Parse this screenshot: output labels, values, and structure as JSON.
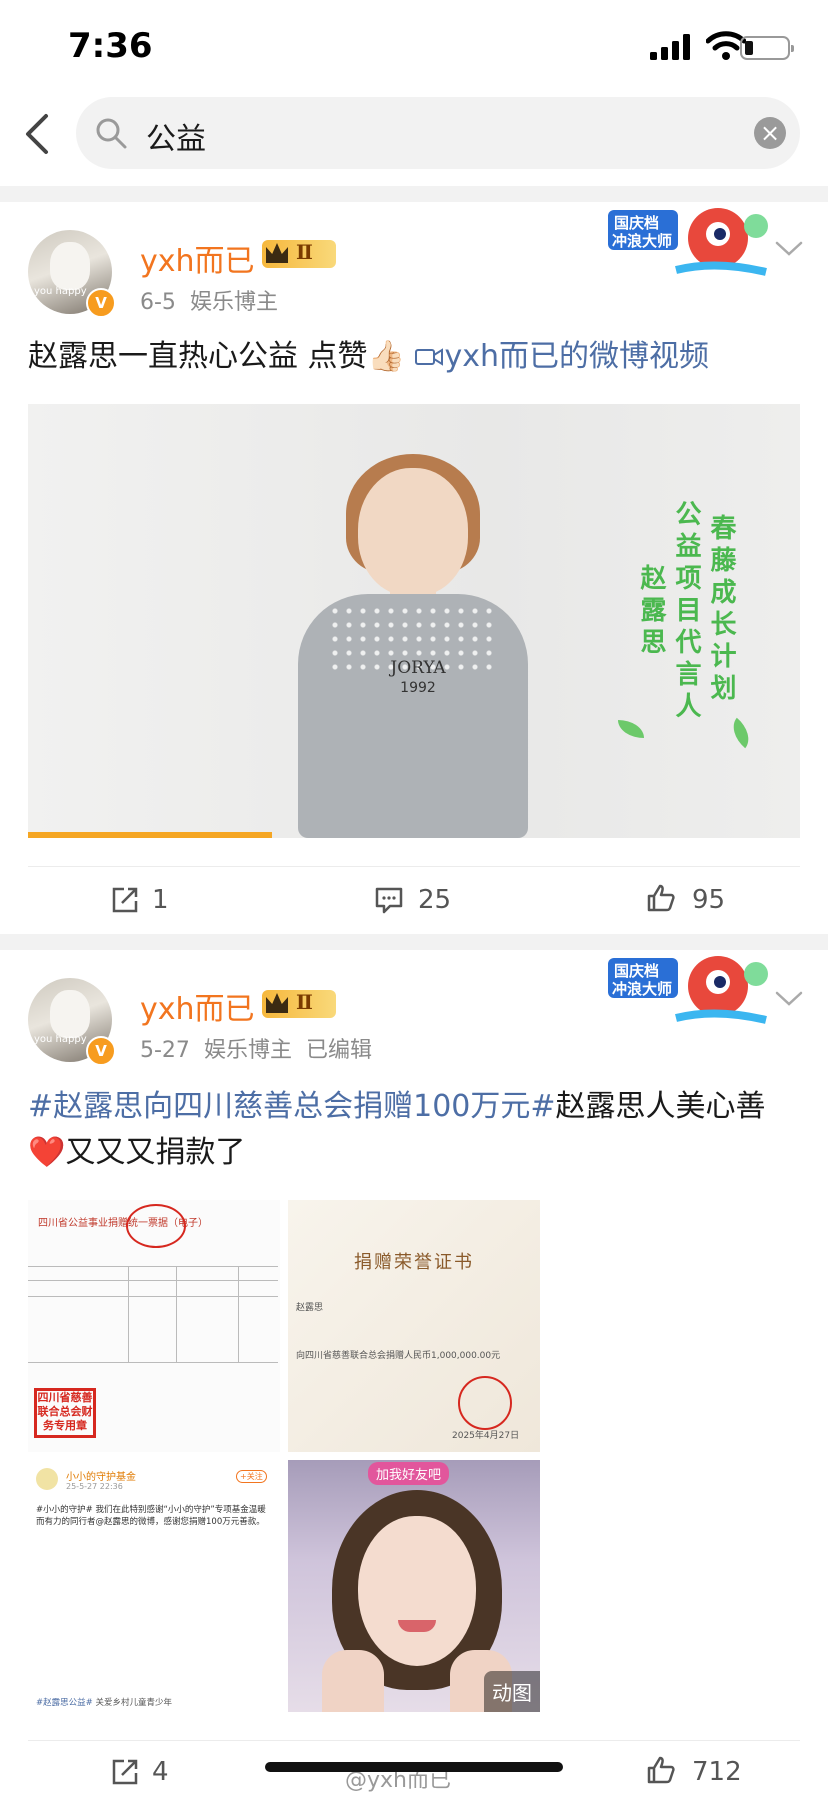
{
  "status_bar": {
    "time": "7:36"
  },
  "search": {
    "value": "公益",
    "clear_glyph": "×"
  },
  "posts": [
    {
      "username": "yxh而已",
      "vip_level": "Ⅱ",
      "date": "6-5",
      "role": "娱乐博主",
      "edited": "",
      "text_plain": "赵露思一直热心公益 点赞👍🏻 ",
      "video_link": "yxh而已的微博视频",
      "holiday_badge": [
        "国庆档",
        "冲浪大师"
      ],
      "video": {
        "shirt_text": "JORYA",
        "shirt_year": "1992",
        "overlay_lines": [
          "春藤成长计划",
          "公益项目代言人",
          "赵露思"
        ],
        "progress": 0.32
      },
      "actions": {
        "repost": "1",
        "comment": "25",
        "like": "95"
      }
    },
    {
      "username": "yxh而已",
      "vip_level": "Ⅱ",
      "date": "5-27",
      "role": "娱乐博主",
      "edited": "已编辑",
      "hashtag1": "#赵露思向四川慈善总会捐赠100万元#",
      "text_after": "赵露思人美心善 ❤️又又又捐款了",
      "holiday_badge": [
        "国庆档",
        "冲浪大师"
      ],
      "images": {
        "receipt_title": "四川省公益事业捐赠统一票据（电子）",
        "receipt_stamp": "四川省慈善联合总会财务专用章",
        "cert_title": "捐赠荣誉证书",
        "cert_name": "赵露思",
        "cert_line": "向四川省慈善联合总会捐赠人民币1,000,000.00元",
        "cert_date": "2025年4月27日",
        "weibo_account": "小小的守护基金",
        "weibo_date": "25-5-27 22:36",
        "weibo_follow": "+关注",
        "weibo_snippet": "#小小的守护# 我们在此特别感谢“小小的守护”专项基金温暖而有力的同行者@赵露思的微博，感谢您捐赠100万元善款。",
        "weibo_tag": "#赵露思公益#",
        "weibo_tail": "关爱乡村儿童青少年",
        "portrait_banner": "加我好友吧",
        "gif_tag": "动图"
      },
      "actions": {
        "repost": "4",
        "comment": "",
        "like": "712"
      }
    }
  ],
  "watermark": "@yxh而已",
  "colors": {
    "accent_orange": "#f2751f",
    "link_blue": "#4d6ea5",
    "progress": "#f5a623"
  }
}
